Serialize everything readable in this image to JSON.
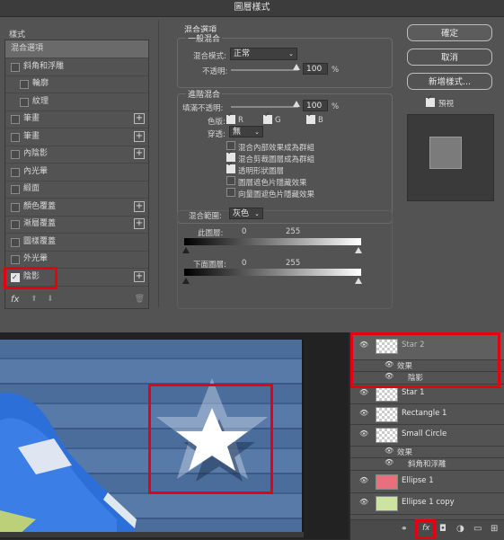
{
  "dialog": {
    "title": "圖層樣式",
    "styles_header": "樣式",
    "style_items": [
      {
        "label": "混合選項",
        "checkbox": false,
        "checked": false,
        "plus": false,
        "selected": true
      },
      {
        "label": "斜角和浮雕",
        "checkbox": true,
        "checked": false,
        "plus": false
      },
      {
        "label": "輪廓",
        "checkbox": true,
        "checked": false,
        "plus": false,
        "indent": true
      },
      {
        "label": "紋理",
        "checkbox": true,
        "checked": false,
        "plus": false,
        "indent": true
      },
      {
        "label": "筆畫",
        "checkbox": true,
        "checked": false,
        "plus": true
      },
      {
        "label": "筆畫",
        "checkbox": true,
        "checked": false,
        "plus": true
      },
      {
        "label": "內陰影",
        "checkbox": true,
        "checked": false,
        "plus": true
      },
      {
        "label": "內光暈",
        "checkbox": true,
        "checked": false,
        "plus": false
      },
      {
        "label": "緞面",
        "checkbox": true,
        "checked": false,
        "plus": false
      },
      {
        "label": "顏色覆蓋",
        "checkbox": true,
        "checked": false,
        "plus": true
      },
      {
        "label": "漸層覆蓋",
        "checkbox": true,
        "checked": false,
        "plus": true
      },
      {
        "label": "圖樣覆蓋",
        "checkbox": true,
        "checked": false,
        "plus": false
      },
      {
        "label": "外光暈",
        "checkbox": true,
        "checked": false,
        "plus": false
      },
      {
        "label": "陰影",
        "checkbox": true,
        "checked": true,
        "plus": true
      }
    ],
    "fx_label": "fx",
    "blend": {
      "section_title": "混合選項",
      "general_title": "一般混合",
      "blend_mode_label": "混合模式:",
      "blend_mode_value": "正常",
      "opacity_label": "不透明:",
      "opacity_value": "100",
      "percent": "%",
      "advanced_title": "進階混合",
      "fill_opacity_label": "填滿不透明:",
      "fill_opacity_value": "100",
      "channels_label": "色版:",
      "channel_r": "R",
      "channel_g": "G",
      "channel_b": "B",
      "knockout_label": "穿透:",
      "knockout_value": "無",
      "options": [
        {
          "label": "混合內部效果成為群組",
          "checked": false
        },
        {
          "label": "混合剪裁圖層成為群組",
          "checked": true
        },
        {
          "label": "透明形狀圖層",
          "checked": true
        },
        {
          "label": "圖層遮色片隱藏效果",
          "checked": false
        },
        {
          "label": "向量圖遮色片隱藏效果",
          "checked": false
        }
      ],
      "blend_if_label": "混合範圍:",
      "blend_if_value": "灰色",
      "this_layer_label": "此圖層:",
      "this_layer_low": "0",
      "this_layer_high": "255",
      "underlying_label": "下面圖層:",
      "underlying_low": "0",
      "underlying_high": "255"
    },
    "buttons": {
      "ok": "確定",
      "cancel": "取消",
      "new_style": "新增樣式...",
      "preview": "預視"
    }
  },
  "layers": [
    {
      "name": "Star 2",
      "selected": true
    },
    {
      "effects_label": "效果",
      "effect": "陰影"
    },
    {
      "name": "Star 1"
    },
    {
      "name": "Rectangle 1"
    },
    {
      "name": "Small Circle",
      "effects_label": "效果",
      "effect": "斜角和浮雕"
    },
    {
      "name": "Ellipse 1"
    },
    {
      "name": "Ellipse 1 copy"
    }
  ],
  "colors": {
    "highlight": "#e60012",
    "dialog_bg": "#535353",
    "ellipse1_thumb": "#e8707c",
    "ellipse1copy_thumb": "#cde3a0"
  }
}
